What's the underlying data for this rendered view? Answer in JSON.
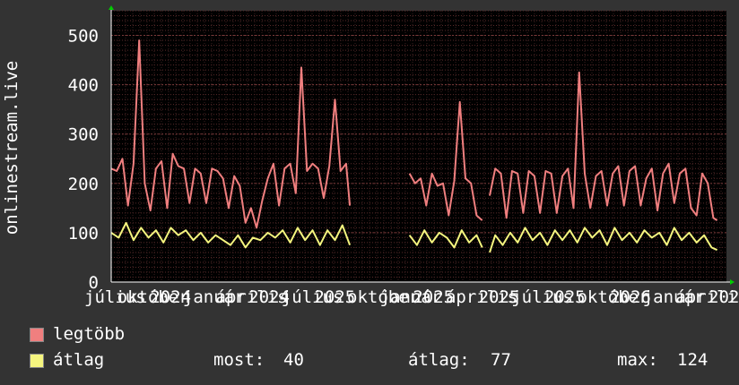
{
  "chart_data": {
    "type": "line",
    "ylabel": "onlinestream.live",
    "ylim": [
      0,
      550
    ],
    "yticks": [
      0,
      100,
      200,
      300,
      400,
      500
    ],
    "xticks": [
      "július",
      "október",
      "2024",
      "január",
      "április",
      "2024",
      "július",
      "2025",
      "október",
      "január",
      "2025",
      "április",
      "2025",
      "július",
      "2025",
      "október",
      "2026",
      "január",
      "április",
      "2026"
    ],
    "grid": true,
    "series": [
      {
        "name": "legtöbb",
        "color": "#f07f7f",
        "segments": [
          [
            [
              0,
              230
            ],
            [
              3,
              225
            ],
            [
              6,
              250
            ],
            [
              9,
              155
            ],
            [
              12,
              240
            ],
            [
              15,
              490
            ],
            [
              18,
              200
            ],
            [
              21,
              145
            ],
            [
              24,
              230
            ],
            [
              27,
              245
            ],
            [
              30,
              150
            ],
            [
              33,
              260
            ],
            [
              36,
              235
            ],
            [
              39,
              230
            ],
            [
              42,
              160
            ],
            [
              45,
              230
            ],
            [
              48,
              220
            ],
            [
              51,
              160
            ],
            [
              54,
              230
            ],
            [
              57,
              225
            ],
            [
              60,
              210
            ],
            [
              63,
              150
            ],
            [
              66,
              215
            ],
            [
              69,
              195
            ],
            [
              72,
              120
            ],
            [
              75,
              150
            ],
            [
              78,
              110
            ],
            [
              81,
              165
            ],
            [
              84,
              210
            ],
            [
              87,
              240
            ],
            [
              90,
              155
            ],
            [
              93,
              230
            ],
            [
              96,
              240
            ],
            [
              99,
              180
            ],
            [
              102,
              435
            ],
            [
              105,
              225
            ],
            [
              108,
              240
            ],
            [
              111,
              230
            ],
            [
              114,
              170
            ],
            [
              117,
              235
            ],
            [
              120,
              370
            ],
            [
              123,
              225
            ],
            [
              126,
              240
            ],
            [
              128,
              155
            ]
          ],
          [
            [
              160,
              220
            ],
            [
              163,
              200
            ],
            [
              166,
              210
            ],
            [
              169,
              155
            ],
            [
              172,
              220
            ],
            [
              175,
              195
            ],
            [
              178,
              200
            ],
            [
              181,
              135
            ],
            [
              184,
              205
            ],
            [
              187,
              365
            ],
            [
              190,
              210
            ],
            [
              193,
              200
            ],
            [
              196,
              135
            ],
            [
              199,
              125
            ]
          ],
          [
            [
              203,
              175
            ],
            [
              206,
              230
            ],
            [
              209,
              220
            ],
            [
              212,
              130
            ],
            [
              215,
              225
            ],
            [
              218,
              220
            ],
            [
              221,
              140
            ],
            [
              224,
              225
            ],
            [
              227,
              215
            ],
            [
              230,
              140
            ],
            [
              233,
              225
            ],
            [
              236,
              220
            ],
            [
              239,
              140
            ],
            [
              242,
              215
            ],
            [
              245,
              230
            ],
            [
              248,
              150
            ],
            [
              251,
              425
            ],
            [
              254,
              220
            ],
            [
              257,
              150
            ],
            [
              260,
              215
            ],
            [
              263,
              225
            ],
            [
              266,
              155
            ],
            [
              269,
              220
            ],
            [
              272,
              235
            ],
            [
              275,
              155
            ],
            [
              278,
              225
            ],
            [
              281,
              235
            ],
            [
              284,
              155
            ],
            [
              287,
              210
            ],
            [
              290,
              230
            ],
            [
              293,
              145
            ],
            [
              296,
              220
            ],
            [
              299,
              240
            ],
            [
              302,
              160
            ],
            [
              305,
              220
            ],
            [
              308,
              230
            ],
            [
              311,
              150
            ],
            [
              314,
              135
            ],
            [
              317,
              220
            ],
            [
              320,
              200
            ],
            [
              323,
              130
            ],
            [
              325,
              125
            ]
          ]
        ]
      },
      {
        "name": "átlag",
        "color": "#f5f57f",
        "segments": [
          [
            [
              0,
              100
            ],
            [
              4,
              90
            ],
            [
              8,
              120
            ],
            [
              12,
              85
            ],
            [
              16,
              110
            ],
            [
              20,
              90
            ],
            [
              24,
              105
            ],
            [
              28,
              80
            ],
            [
              32,
              110
            ],
            [
              36,
              95
            ],
            [
              40,
              105
            ],
            [
              44,
              85
            ],
            [
              48,
              100
            ],
            [
              52,
              80
            ],
            [
              56,
              95
            ],
            [
              60,
              85
            ],
            [
              64,
              75
            ],
            [
              68,
              95
            ],
            [
              72,
              70
            ],
            [
              76,
              90
            ],
            [
              80,
              85
            ],
            [
              84,
              100
            ],
            [
              88,
              90
            ],
            [
              92,
              105
            ],
            [
              96,
              80
            ],
            [
              100,
              110
            ],
            [
              104,
              85
            ],
            [
              108,
              105
            ],
            [
              112,
              75
            ],
            [
              116,
              105
            ],
            [
              120,
              85
            ],
            [
              124,
              115
            ],
            [
              128,
              75
            ]
          ],
          [
            [
              160,
              95
            ],
            [
              164,
              75
            ],
            [
              168,
              105
            ],
            [
              172,
              80
            ],
            [
              176,
              100
            ],
            [
              180,
              90
            ],
            [
              184,
              70
            ],
            [
              188,
              105
            ],
            [
              192,
              80
            ],
            [
              196,
              95
            ],
            [
              199,
              70
            ]
          ],
          [
            [
              203,
              60
            ],
            [
              206,
              95
            ],
            [
              210,
              75
            ],
            [
              214,
              100
            ],
            [
              218,
              80
            ],
            [
              222,
              110
            ],
            [
              226,
              85
            ],
            [
              230,
              100
            ],
            [
              234,
              75
            ],
            [
              238,
              105
            ],
            [
              242,
              85
            ],
            [
              246,
              105
            ],
            [
              250,
              80
            ],
            [
              254,
              110
            ],
            [
              258,
              90
            ],
            [
              262,
              105
            ],
            [
              266,
              75
            ],
            [
              270,
              110
            ],
            [
              274,
              85
            ],
            [
              278,
              100
            ],
            [
              282,
              80
            ],
            [
              286,
              105
            ],
            [
              290,
              90
            ],
            [
              294,
              100
            ],
            [
              298,
              75
            ],
            [
              302,
              110
            ],
            [
              306,
              85
            ],
            [
              310,
              100
            ],
            [
              314,
              80
            ],
            [
              318,
              95
            ],
            [
              322,
              70
            ],
            [
              325,
              65
            ]
          ]
        ]
      }
    ],
    "stats": {
      "most_label": "most:",
      "most": "40",
      "avg_label": "átlag:",
      "avg": "77",
      "max_label": "max:",
      "max": "124"
    }
  }
}
